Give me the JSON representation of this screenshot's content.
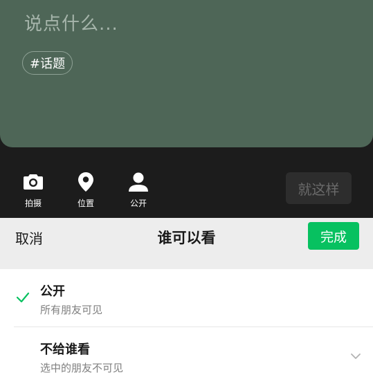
{
  "compose": {
    "placeholder": "说点什么...",
    "topic_chip": "#话题"
  },
  "toolbar": {
    "tools": [
      {
        "label": "拍摄",
        "icon": "camera-icon"
      },
      {
        "label": "位置",
        "icon": "location-pin-icon"
      },
      {
        "label": "公开",
        "icon": "person-icon"
      }
    ],
    "post_button": "就这样"
  },
  "visibility_sheet": {
    "cancel_label": "取消",
    "title": "谁可以看",
    "done_label": "完成",
    "options": [
      {
        "title": "公开",
        "subtitle": "所有朋友可见",
        "selected": true
      },
      {
        "title": "不给谁看",
        "subtitle": "选中的朋友不可见",
        "selected": false
      }
    ]
  },
  "colors": {
    "accent_green": "#07c160",
    "compose_background": "#4e6657",
    "toolbar_background": "#1c1c1c"
  }
}
